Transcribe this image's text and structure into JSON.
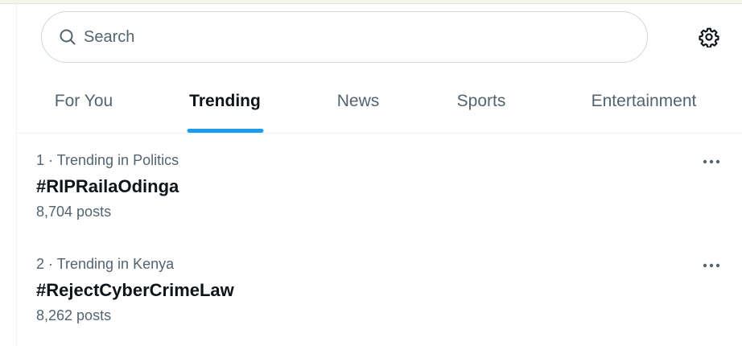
{
  "search": {
    "placeholder": "Search"
  },
  "tabs": [
    {
      "label": "For You",
      "active": false
    },
    {
      "label": "Trending",
      "active": true
    },
    {
      "label": "News",
      "active": false
    },
    {
      "label": "Sports",
      "active": false
    },
    {
      "label": "Entertainment",
      "active": false
    }
  ],
  "trends": [
    {
      "meta": "1 · Trending in Politics",
      "title": "#RIPRailaOdinga",
      "posts": "8,704 posts"
    },
    {
      "meta": "2 · Trending in Kenya",
      "title": "#RejectCyberCrimeLaw",
      "posts": "8,262 posts"
    }
  ],
  "colors": {
    "accent": "#1d9bf0",
    "text_primary": "#0f1419",
    "text_secondary": "#536471",
    "border": "#cfd9de"
  },
  "icons": {
    "search": "search-icon",
    "settings": "gear-icon",
    "more": "more-horizontal-icon"
  }
}
